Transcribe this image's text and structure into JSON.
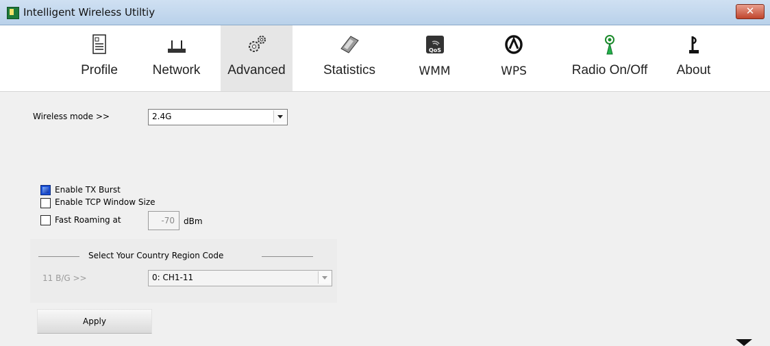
{
  "window": {
    "title": "Intelligent Wireless Utiltiy",
    "close_label": "✕"
  },
  "toolbar": [
    {
      "label": "Profile",
      "icon": "profile-icon"
    },
    {
      "label": "Network",
      "icon": "network-icon"
    },
    {
      "label": "Advanced",
      "icon": "advanced-gears-icon",
      "active": true
    },
    {
      "label": "Statistics",
      "icon": "statistics-calculator-icon"
    },
    {
      "label": "WMM",
      "icon": "wmm-qos-icon",
      "icon_text": "QoS"
    },
    {
      "label": "WPS",
      "icon": "wps-icon"
    },
    {
      "label": "Radio On/Off",
      "icon": "radio-antenna-icon"
    },
    {
      "label": "About",
      "icon": "about-icon"
    }
  ],
  "advanced": {
    "wireless_mode_label": "Wireless mode >>",
    "wireless_mode_value": "2.4G",
    "tx_burst_label": "Enable TX Burst",
    "tx_burst_checked": true,
    "tcp_window_label": "Enable TCP Window Size",
    "tcp_window_checked": false,
    "fast_roaming_label": "Fast Roaming at",
    "fast_roaming_checked": false,
    "fast_roaming_value": "-70",
    "fast_roaming_unit": "dBm",
    "region_group_title": "Select Your Country Region Code",
    "region_11bg_label": "11 B/G >>",
    "region_11bg_value": "0: CH1-11",
    "apply_label": "Apply"
  }
}
